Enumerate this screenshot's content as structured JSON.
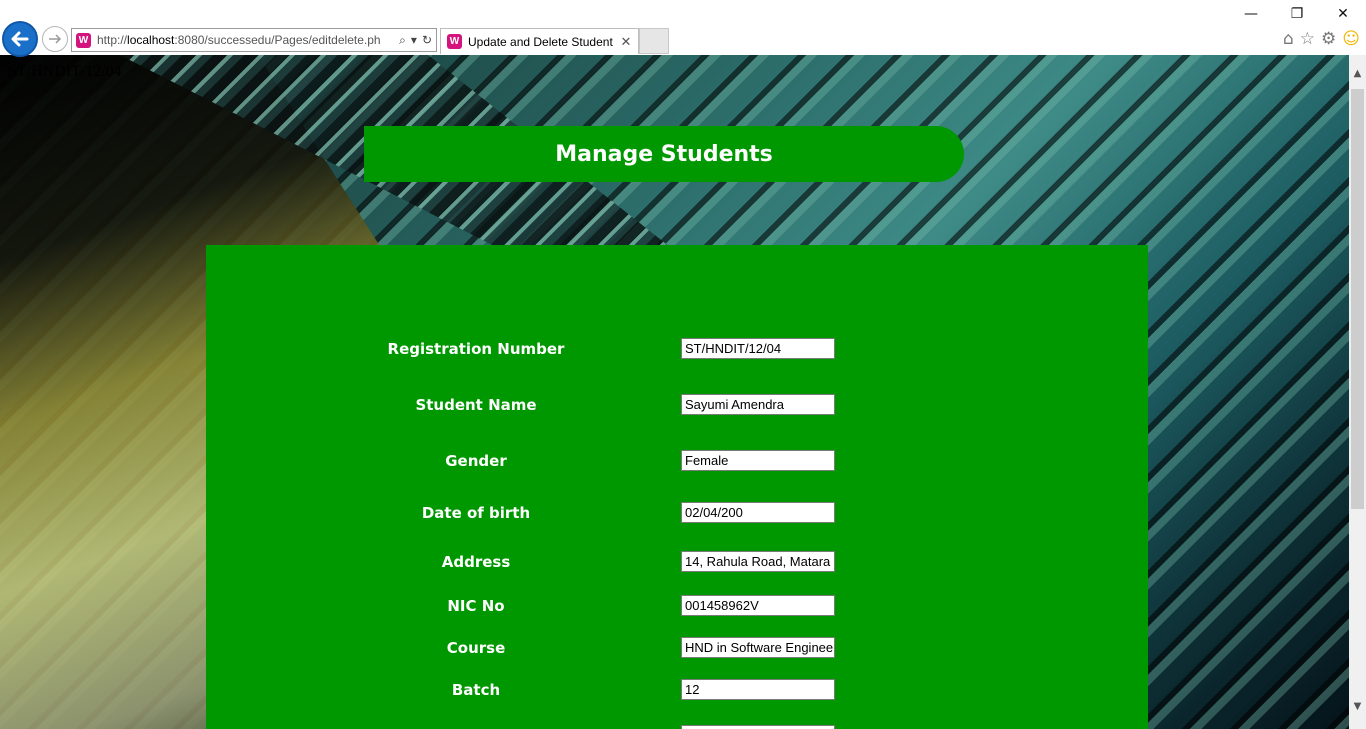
{
  "browser": {
    "url_prefix": "http://",
    "url_host": "localhost",
    "url_rest": ":8080/successedu/Pages/editdelete.ph",
    "tab_title": "Update and Delete Student",
    "site_icon": "W"
  },
  "page": {
    "corner_text": "ST/HNDIT/12/04",
    "title": "Manage Students",
    "fields": [
      {
        "label": "Registration Number",
        "value": "ST/HNDIT/12/04"
      },
      {
        "label": "Student Name",
        "value": "Sayumi Amendra"
      },
      {
        "label": "Gender",
        "value": "Female"
      },
      {
        "label": "Date of birth",
        "value": "02/04/200"
      },
      {
        "label": "Address",
        "value": "14, Rahula Road, Matara"
      },
      {
        "label": "NIC No",
        "value": "001458962V"
      },
      {
        "label": "Course",
        "value": "HND in Software Enginee"
      },
      {
        "label": "Batch",
        "value": "12"
      }
    ]
  },
  "colors": {
    "panel_green": "#009800",
    "back_button_blue": "#1a6fc9"
  }
}
